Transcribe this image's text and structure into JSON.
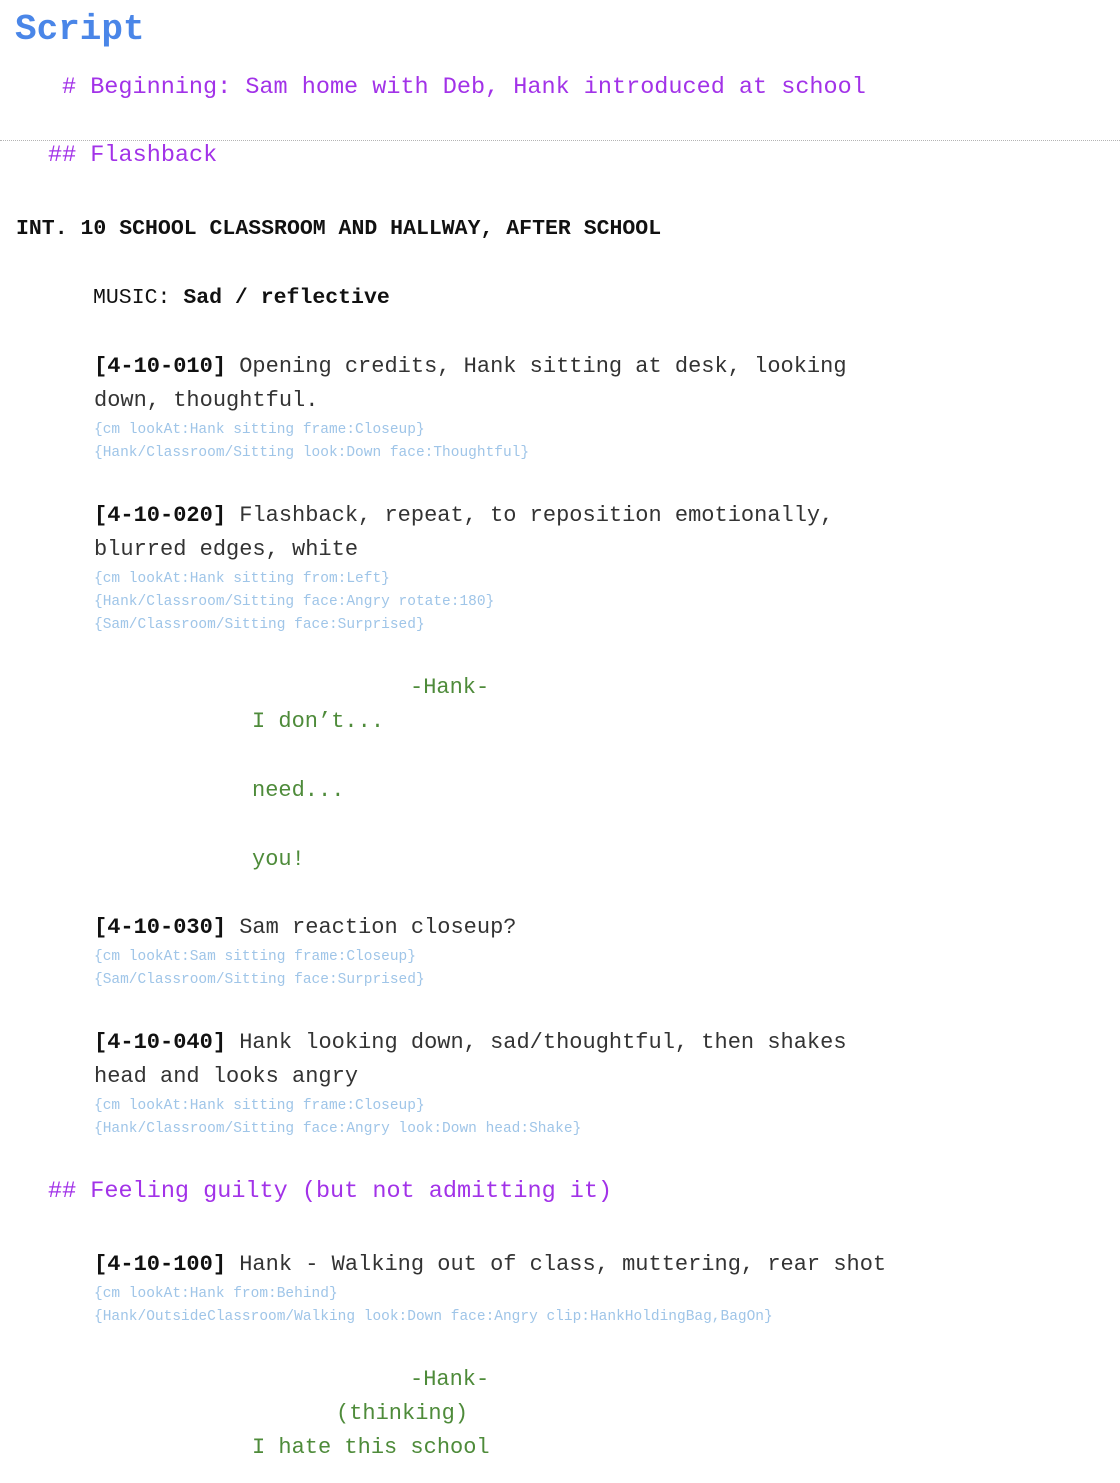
{
  "title": "Script",
  "beginning_heading": "# Beginning: Sam home with Deb, Hank introduced at school",
  "section_flashback": "## Flashback",
  "scene_heading": "INT. 10 SCHOOL CLASSROOM AND HALLWAY, AFTER SCHOOL",
  "music": {
    "label": "MUSIC:",
    "value": "Sad / reflective"
  },
  "shots": [
    {
      "id": "[4-10-010]",
      "text_line1": " Opening credits, Hank sitting at desk, looking",
      "text_line2": "down, thoughtful.",
      "cues": [
        "{cm lookAt:Hank sitting frame:Closeup}",
        "{Hank/Classroom/Sitting look:Down face:Thoughtful}"
      ]
    },
    {
      "id": "[4-10-020]",
      "text_line1": " Flashback, repeat, to reposition emotionally,",
      "text_line2": "blurred edges, white",
      "cues": [
        "{cm lookAt:Hank sitting from:Left}",
        "{Hank/Classroom/Sitting face:Angry rotate:180}",
        "{Sam/Classroom/Sitting face:Surprised}"
      ]
    },
    {
      "id": "[4-10-030]",
      "text_line1": " Sam reaction closeup?",
      "text_line2": "",
      "cues": [
        "{cm lookAt:Sam sitting frame:Closeup}",
        "{Sam/Classroom/Sitting face:Surprised}"
      ]
    },
    {
      "id": "[4-10-040]",
      "text_line1": " Hank looking down, sad/thoughtful, then shakes",
      "text_line2": "head and looks angry",
      "cues": [
        "{cm lookAt:Hank sitting frame:Closeup}",
        "{Hank/Classroom/Sitting face:Angry look:Down head:Shake}"
      ]
    },
    {
      "id": "[4-10-100]",
      "text_line1": " Hank - Walking out of class, muttering, rear shot",
      "text_line2": "",
      "cues": [
        "{cm lookAt:Hank from:Behind}",
        "{Hank/OutsideClassroom/Walking look:Down face:Angry clip:HankHoldingBag,BagOn}"
      ]
    }
  ],
  "dialogue_1": {
    "character": "-Hank-",
    "lines": [
      "I don’t...",
      "need...",
      "you!"
    ]
  },
  "section_guilty": "## Feeling guilty (but not admitting it)",
  "dialogue_2": {
    "character": "-Hank-",
    "parenthetical": "(thinking)",
    "lines": [
      "I hate this school"
    ]
  }
}
